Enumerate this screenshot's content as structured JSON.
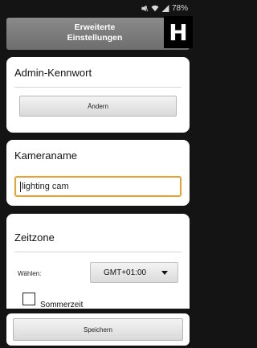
{
  "status": {
    "battery": "78%",
    "icons": [
      "mute-icon",
      "wifi-icon",
      "signal-icon"
    ]
  },
  "header": {
    "title_line1": "Erweiterte",
    "title_line2": "Einstellungen",
    "badge": "H"
  },
  "admin": {
    "title": "Admin-Kennwort",
    "change_label": "Ändern"
  },
  "camera": {
    "title": "Kameraname",
    "value": "lighting cam"
  },
  "timezone": {
    "title": "Zeitzone",
    "select_label": "Wählen:",
    "selected": "GMT+01:00",
    "dst_label": "Sommerzeit",
    "dst_checked": false
  },
  "footer": {
    "save_label": "Speichern"
  },
  "colors": {
    "focus_border": "#e8a030",
    "header_gray": "#7a7a7a"
  }
}
